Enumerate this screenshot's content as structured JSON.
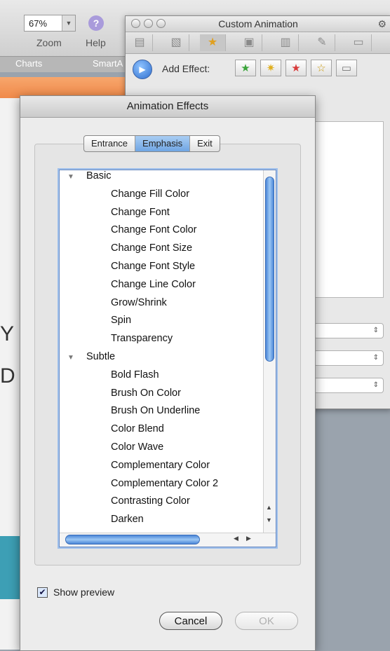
{
  "app": {
    "zoom_value": "67%",
    "labels": {
      "zoom": "Zoom",
      "help": "Help"
    },
    "ribbon_tabs": [
      "Charts",
      "SmartA"
    ]
  },
  "custom_animation": {
    "title": "Custom Animation",
    "add_effect_label": "Add Effect:",
    "tools": [
      "animation-icon",
      "picture-icon",
      "custom-animation-icon",
      "media-icon",
      "charts-icon",
      "tools-icon",
      "toolbox-icon"
    ]
  },
  "dialog": {
    "title": "Animation Effects",
    "tabs": [
      "Entrance",
      "Emphasis",
      "Exit"
    ],
    "selected_tab": "Emphasis",
    "list": [
      {
        "type": "category",
        "label": "Basic"
      },
      {
        "type": "item",
        "label": "Change Fill Color"
      },
      {
        "type": "item",
        "label": "Change Font"
      },
      {
        "type": "item",
        "label": "Change Font Color"
      },
      {
        "type": "item",
        "label": "Change Font Size"
      },
      {
        "type": "item",
        "label": "Change Font Style"
      },
      {
        "type": "item",
        "label": "Change Line Color"
      },
      {
        "type": "item",
        "label": "Grow/Shrink"
      },
      {
        "type": "item",
        "label": "Spin"
      },
      {
        "type": "item",
        "label": "Transparency"
      },
      {
        "type": "category",
        "label": "Subtle"
      },
      {
        "type": "item",
        "label": "Bold Flash"
      },
      {
        "type": "item",
        "label": "Brush On Color"
      },
      {
        "type": "item",
        "label": "Brush On Underline"
      },
      {
        "type": "item",
        "label": "Color Blend"
      },
      {
        "type": "item",
        "label": "Color Wave"
      },
      {
        "type": "item",
        "label": "Complementary Color"
      },
      {
        "type": "item",
        "label": "Complementary Color 2"
      },
      {
        "type": "item",
        "label": "Contrasting Color"
      },
      {
        "type": "item",
        "label": "Darken"
      }
    ],
    "show_preview_label": "Show preview",
    "show_preview_checked": true,
    "cancel_label": "Cancel",
    "ok_label": "OK",
    "ok_enabled": false
  }
}
